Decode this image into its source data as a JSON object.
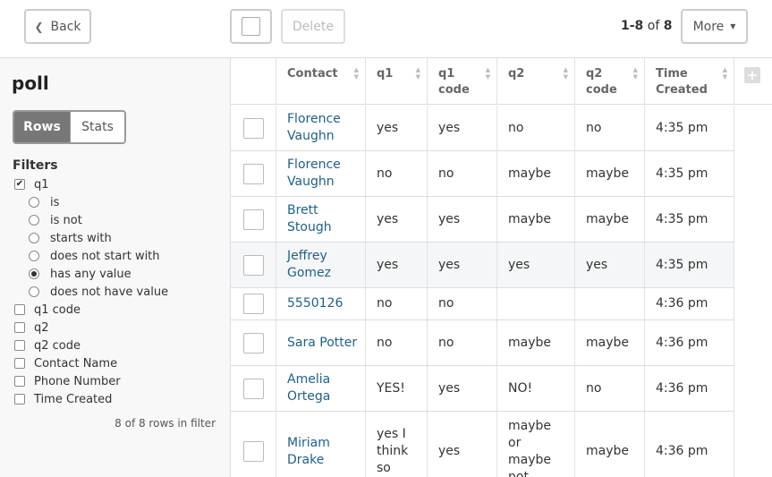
{
  "toolbar": {
    "back_label": "Back",
    "delete_label": "Delete",
    "pager_range": "1-8",
    "pager_of": "of",
    "pager_total": "8",
    "more_label": "More"
  },
  "sidebar": {
    "title": "poll",
    "view_rows": "Rows",
    "view_stats": "Stats",
    "filters_label": "Filters",
    "q1_label": "q1",
    "q1_checked": true,
    "operators": [
      {
        "label": "is",
        "selected": false
      },
      {
        "label": "is not",
        "selected": false
      },
      {
        "label": "starts with",
        "selected": false
      },
      {
        "label": "does not start with",
        "selected": false
      },
      {
        "label": "has any value",
        "selected": true
      },
      {
        "label": "does not have value",
        "selected": false
      }
    ],
    "other_filters": [
      "q1 code",
      "q2",
      "q2 code",
      "Contact Name",
      "Phone Number",
      "Time Created"
    ],
    "row_count": "8 of 8 rows in filter"
  },
  "table": {
    "headers": [
      "Contact",
      "q1",
      "q1\ncode",
      "q2",
      "q2\ncode",
      "Time\nCreated"
    ],
    "rows": [
      {
        "contact": "Florence Vaughn",
        "q1": "yes",
        "q1_code": "yes",
        "q2": "no",
        "q2_code": "no",
        "time": "4:35 pm"
      },
      {
        "contact": "Florence Vaughn",
        "q1": "no",
        "q1_code": "no",
        "q2": "maybe",
        "q2_code": "maybe",
        "time": "4:35 pm"
      },
      {
        "contact": "Brett Stough",
        "q1": "yes",
        "q1_code": "yes",
        "q2": "maybe",
        "q2_code": "maybe",
        "time": "4:35 pm"
      },
      {
        "contact": "Jeffrey Gomez",
        "q1": "yes",
        "q1_code": "yes",
        "q2": "yes",
        "q2_code": "yes",
        "time": "4:35 pm"
      },
      {
        "contact": "5550126",
        "q1": "no",
        "q1_code": "no",
        "q2": "",
        "q2_code": "",
        "time": "4:36 pm"
      },
      {
        "contact": "Sara Potter",
        "q1": "no",
        "q1_code": "no",
        "q2": "maybe",
        "q2_code": "maybe",
        "time": "4:36 pm"
      },
      {
        "contact": "Amelia Ortega",
        "q1": "YES!",
        "q1_code": "yes",
        "q2": "NO!",
        "q2_code": "no",
        "time": "4:36 pm"
      },
      {
        "contact": "Miriam Drake",
        "q1": "yes I think so",
        "q1_code": "yes",
        "q2": "maybe or maybe not",
        "q2_code": "maybe",
        "time": "4:36 pm"
      }
    ]
  },
  "icons": {
    "back": "chevron-left-icon",
    "more": "caret-down-icon",
    "add_column": "plus-icon",
    "sort": "sort-arrows-icon"
  }
}
